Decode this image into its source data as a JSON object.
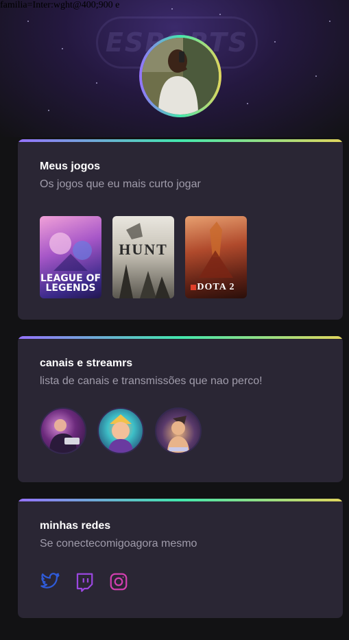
{
  "debug_font_text": "familia=Inter:wght@400;900 e",
  "header": {
    "watermark": "ESPORTS"
  },
  "profile": {
    "avatar_icon": "user-photo"
  },
  "games_card": {
    "title": "Meus jogos",
    "subtitle": "Os jogos que eu mais curto jogar",
    "games": [
      {
        "name": "LEAGUE OF LEGENDS"
      },
      {
        "name": "HUNT"
      },
      {
        "name": "DOTA 2"
      }
    ]
  },
  "streamers_card": {
    "title": "canais e streamrs",
    "subtitle": "lista de canais e transmissões que nao perco!",
    "streamers": [
      {
        "icon": "streamer-avatar-1"
      },
      {
        "icon": "streamer-avatar-2"
      },
      {
        "icon": "streamer-avatar-3"
      }
    ]
  },
  "social_card": {
    "title": "minhas redes",
    "subtitle": "Se conectecomigoagora mesmo",
    "links": [
      {
        "icon": "twitter-icon",
        "color": "#2f5bd8"
      },
      {
        "icon": "twitch-icon",
        "color": "#9b47e0"
      },
      {
        "icon": "instagram-icon",
        "color": "#d23fb0"
      }
    ]
  },
  "colors": {
    "background": "#121214",
    "card": "#2a2634",
    "gradient_start": "#9572fc",
    "gradient_mid": "#43e7ad",
    "gradient_end": "#e1d55d",
    "subtitle": "#a09cab"
  }
}
